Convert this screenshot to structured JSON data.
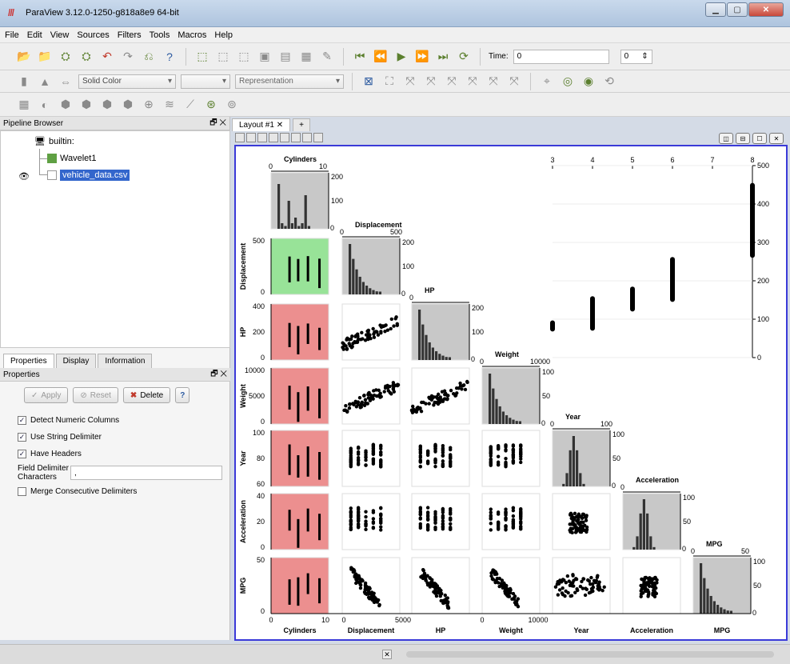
{
  "window": {
    "title": "ParaView 3.12.0-1250-g818a8e9 64-bit"
  },
  "menu": [
    "File",
    "Edit",
    "View",
    "Sources",
    "Filters",
    "Tools",
    "Macros",
    "Help"
  ],
  "toolbar": {
    "time_label": "Time:",
    "time_value": "0",
    "time_index": "0",
    "color_combo": "Solid Color",
    "representation_combo": "Representation"
  },
  "pipeline": {
    "header": "Pipeline Browser",
    "root": "builtin:",
    "items": [
      "Wavelet1",
      "vehicle_data.csv"
    ]
  },
  "tabs": [
    "Properties",
    "Display",
    "Information"
  ],
  "properties": {
    "header": "Properties",
    "apply": "Apply",
    "reset": "Reset",
    "delete": "Delete",
    "help": "?",
    "options": [
      {
        "label": "Detect Numeric Columns",
        "checked": true
      },
      {
        "label": "Use String Delimiter",
        "checked": true
      },
      {
        "label": "Have Headers",
        "checked": true
      }
    ],
    "delimiter_label_1": "Field Delimiter",
    "delimiter_label_2": "Characters",
    "delimiter_value": ",",
    "merge_label": "Merge Consecutive Delimiters"
  },
  "layout": {
    "tab_label": "Layout #1",
    "plus": "+"
  },
  "chart_data": {
    "type": "scatter",
    "variables": [
      "Cylinders",
      "Displacement",
      "HP",
      "Weight",
      "Year",
      "Acceleration",
      "MPG"
    ],
    "histogram_axis_max": [
      "200",
      "200",
      "200",
      "100",
      "100",
      "100",
      "100"
    ],
    "histogram_axis_mid": [
      "100",
      "100",
      "100",
      "50",
      "50",
      "50",
      "50"
    ],
    "diag_xmax": [
      "10",
      "500",
      "",
      "10000",
      "100",
      "",
      "50"
    ],
    "y_ranges": {
      "Displacement": [
        "0",
        "500"
      ],
      "HP": [
        "0",
        "200",
        "400"
      ],
      "Weight": [
        "0",
        "5000",
        "10000"
      ],
      "Year": [
        "60",
        "80",
        "100"
      ],
      "Acceleration": [
        "0",
        "20",
        "40"
      ],
      "MPG": [
        "0",
        "50"
      ]
    },
    "x_ticks_bottom": {
      "Cylinders": [
        "0",
        "10"
      ],
      "Displacement": [
        "0",
        "5000"
      ],
      "Weight": [
        "0",
        "10000"
      ]
    },
    "big_plot": {
      "x_label": "Cylinders",
      "y_label": "Displacement",
      "x_ticks": [
        "3",
        "4",
        "5",
        "6",
        "7",
        "8"
      ],
      "y_ticks": [
        "0",
        "100",
        "200",
        "300",
        "400",
        "500"
      ],
      "xlim": [
        3,
        8
      ],
      "ylim": [
        0,
        500
      ],
      "columns": [
        {
          "x": 3,
          "ymin": 68,
          "ymax": 97
        },
        {
          "x": 4,
          "ymin": 70,
          "ymax": 160
        },
        {
          "x": 5,
          "ymin": 120,
          "ymax": 185
        },
        {
          "x": 6,
          "ymin": 145,
          "ymax": 262
        },
        {
          "x": 8,
          "ymin": 260,
          "ymax": 455
        }
      ]
    },
    "highlight_colors": {
      "selected": "#98e398",
      "row": "#ec8f8f",
      "hist": "#c8c8c8"
    }
  }
}
